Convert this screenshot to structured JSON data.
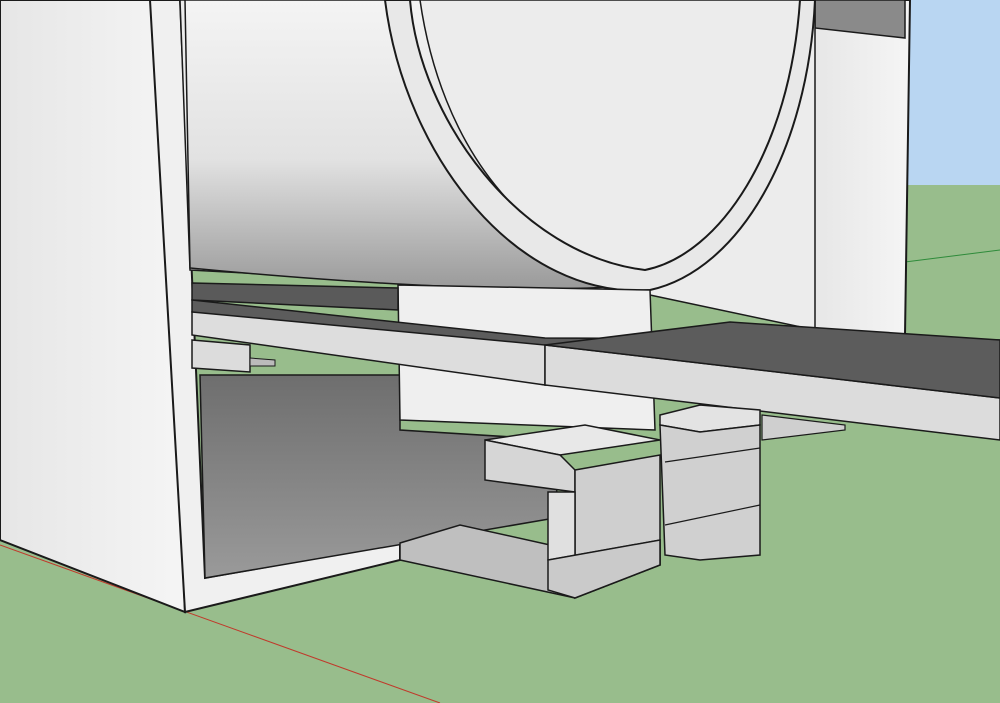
{
  "scene": {
    "colors": {
      "sky": "#b9d6f2",
      "ground": "#98bd8c",
      "edge": "#1a1a1a",
      "wall_light": "#efefef",
      "wall_shade": "#dcdcdc",
      "interior_dark": "#777777",
      "top_face_dark": "#5c5c5c",
      "face_mid": "#c8c8c8",
      "red_axis": "#c0392b",
      "green_axis": "#2e8b3a"
    },
    "objects": [
      "enclosure-box",
      "cylinder-drum",
      "table-rail",
      "support-block-front",
      "support-block-rear"
    ]
  }
}
